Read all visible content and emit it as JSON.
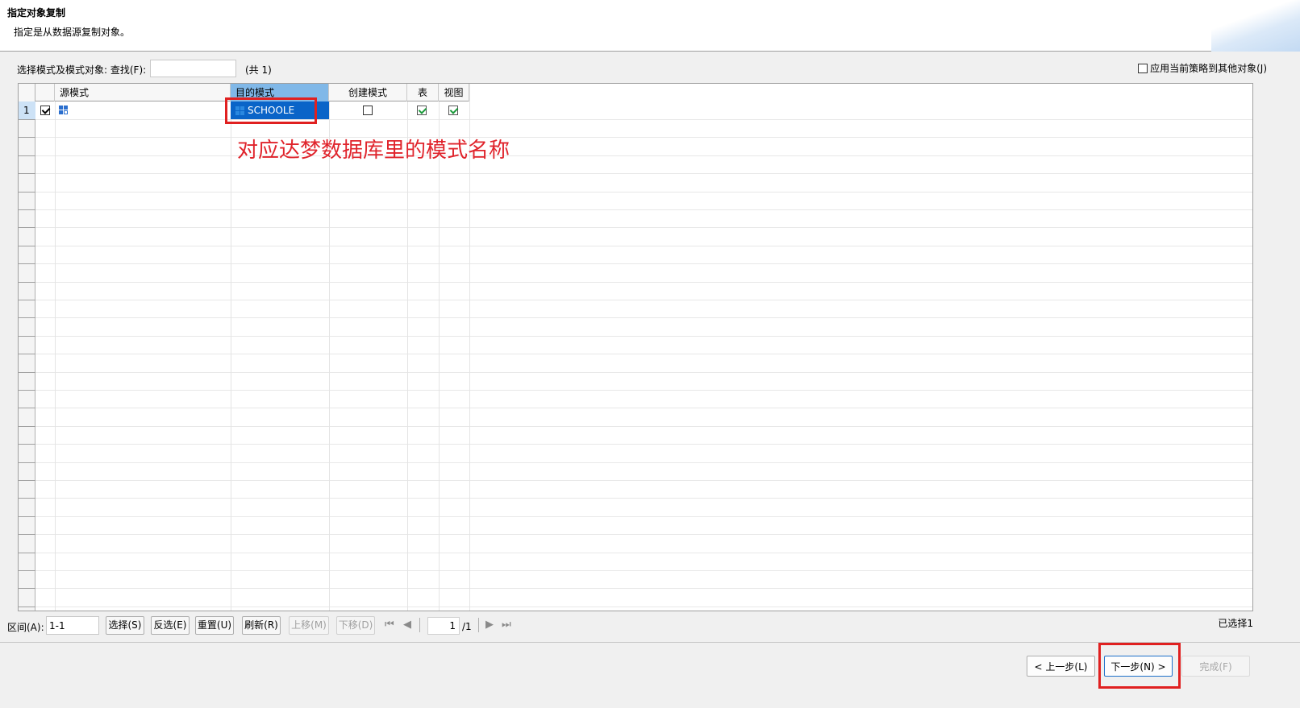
{
  "header": {
    "title": "指定对象复制",
    "description": "指定是从数据源复制对象。"
  },
  "filter": {
    "label": "选择模式及模式对象: 查找(F):",
    "search_value": "",
    "count_text": "(共 1)",
    "apply_all_label": "应用当前策略到其他对象(J)",
    "apply_all_checked": false
  },
  "grid": {
    "columns": {
      "source_schema": "源模式",
      "target_schema": "目的模式",
      "create_schema": "创建模式",
      "table": "表",
      "view": "视图"
    },
    "rows": [
      {
        "index": "1",
        "selected": true,
        "source_schema": "",
        "target_schema": "SCHOOLE",
        "create_schema": false,
        "table": true,
        "view": true
      }
    ]
  },
  "annotation": "对应达梦数据库里的模式名称",
  "navigation": {
    "range_label": "区间(A):",
    "range_value": "1-1",
    "select_label": "选择(S)",
    "invert_label": "反选(E)",
    "reset_label": "重置(U)",
    "refresh_label": "刷新(R)",
    "move_up_label": "上移(M)",
    "move_down_label": "下移(D)",
    "page_value": "1",
    "page_total": "/1",
    "selected_count": "已选择1"
  },
  "footer": {
    "prev_label": "< 上一步(L)",
    "next_label": "下一步(N) >",
    "finish_label": "完成(F)"
  },
  "colors": {
    "selection_blue": "#0a64c8",
    "header_selected": "#80b8e8",
    "annotation_red": "#e0242c"
  }
}
